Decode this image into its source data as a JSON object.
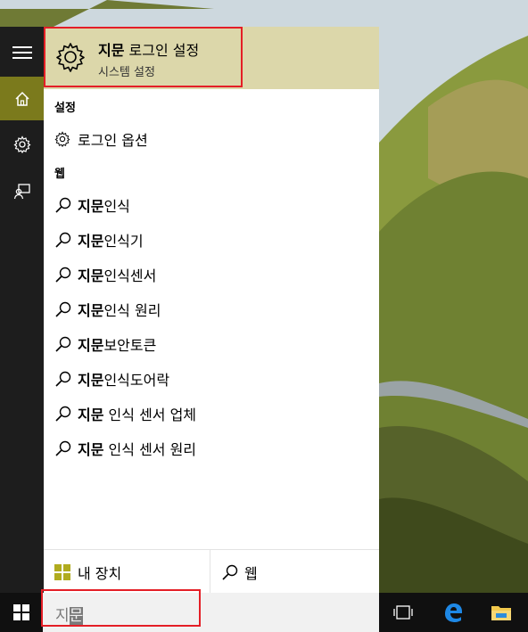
{
  "best_match": {
    "title_bold": "지문",
    "title_rest": " 로그인 설정",
    "subtitle": "시스템 설정"
  },
  "sections": {
    "settings": "설정",
    "web": "웹"
  },
  "settings_items": [
    {
      "label": "로그인 옵션",
      "icon": "gear-icon"
    }
  ],
  "web_items": [
    {
      "bold": "지문",
      "rest": "인식"
    },
    {
      "bold": "지문",
      "rest": "인식기"
    },
    {
      "bold": "지문",
      "rest": "인식센서"
    },
    {
      "bold": "지문",
      "rest": "인식 원리"
    },
    {
      "bold": "지문",
      "rest": "보안토큰"
    },
    {
      "bold": "지문",
      "rest": "인식도어락"
    },
    {
      "bold": "지문",
      "rest": " 인식 센서 업체"
    },
    {
      "bold": "지문",
      "rest": " 인식 센서 원리"
    }
  ],
  "scope": {
    "my_stuff": "내 장치",
    "web": "웹"
  },
  "search": {
    "typed": "지",
    "composing": "문"
  },
  "rail": [
    "hamburger-menu-icon",
    "home-icon",
    "gear-icon",
    "feedback-icon"
  ],
  "taskbar_icons": [
    "windows-logo-icon",
    "task-view-icon",
    "edge-icon",
    "file-explorer-icon"
  ],
  "colors": {
    "accent": "#7b7a1c",
    "best_match_bg": "#dcd7aa",
    "highlight": "#e41e26",
    "taskbar": "#101010",
    "rail": "#1d1d1d"
  }
}
